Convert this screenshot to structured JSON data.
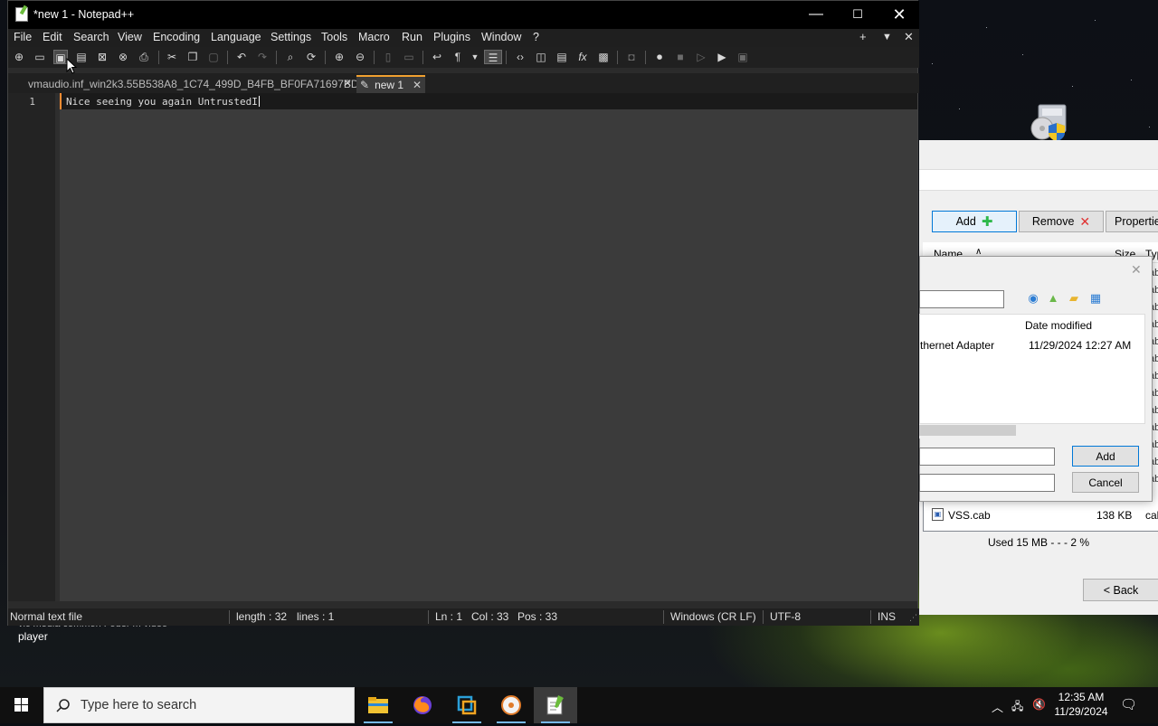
{
  "notepad": {
    "title": "*new 1 - Notepad++",
    "window_controls": {
      "minimize": "—",
      "maximize": "☐",
      "close": "✕"
    },
    "menu": [
      "File",
      "Edit",
      "Search",
      "View",
      "Encoding",
      "Language",
      "Settings",
      "Tools",
      "Macro",
      "Run",
      "Plugins",
      "Window",
      "?"
    ],
    "menu_right": {
      "add": "+",
      "list": "▼",
      "close": "✕"
    },
    "tabs": [
      {
        "label": "vmaudio.inf_win2k3.55B538A8_1C74_499D_B4FB_BF0FA71697BD",
        "active": false
      },
      {
        "label": "new 1",
        "active": true
      }
    ],
    "editor": {
      "line_number": "1",
      "content": "Nice seeing you again UntrustedI"
    },
    "status": {
      "file_type": "Normal text file",
      "length": "length : 32",
      "lines": "lines : 1",
      "ln": "Ln : 1",
      "col": "Col : 33",
      "pos": "Pos : 33",
      "eol": "Windows (CR LF)",
      "encoding": "UTF-8",
      "mode": "INS"
    }
  },
  "background_app": {
    "buttons": {
      "add": "Add",
      "remove": "Remove",
      "properties": "Propertie"
    },
    "list_header": {
      "name": "Name",
      "sort": "∧",
      "size": "Size",
      "type": "Typ"
    },
    "type_cells": [
      "ab",
      "ab",
      "ab",
      "ab",
      "ab",
      "ab",
      "ab",
      "ab",
      "ab",
      "ab",
      "ab",
      "ab",
      "ab"
    ],
    "row": {
      "name": "VSS.cab",
      "size": "138 KB",
      "type": "cab"
    },
    "used": "Used  15 MB   - - -  2 %",
    "back_button": "< Back"
  },
  "dialog": {
    "column_date": "Date modified",
    "item_name": "thernet Adapter",
    "item_date": "11/29/2024 12:27 AM",
    "add_button": "Add",
    "cancel_button": "Cancel"
  },
  "desktop": {
    "label_player": "player",
    "label_under": "vic media   common   Foder   m video"
  },
  "taskbar": {
    "search_placeholder": "Type here to search",
    "time": "12:35 AM",
    "date": "11/29/2024"
  },
  "colors": {
    "accent_tab": "#f0a030",
    "current_line_marker": "#ff8c32",
    "taskbar_active": "#76b9ed"
  }
}
